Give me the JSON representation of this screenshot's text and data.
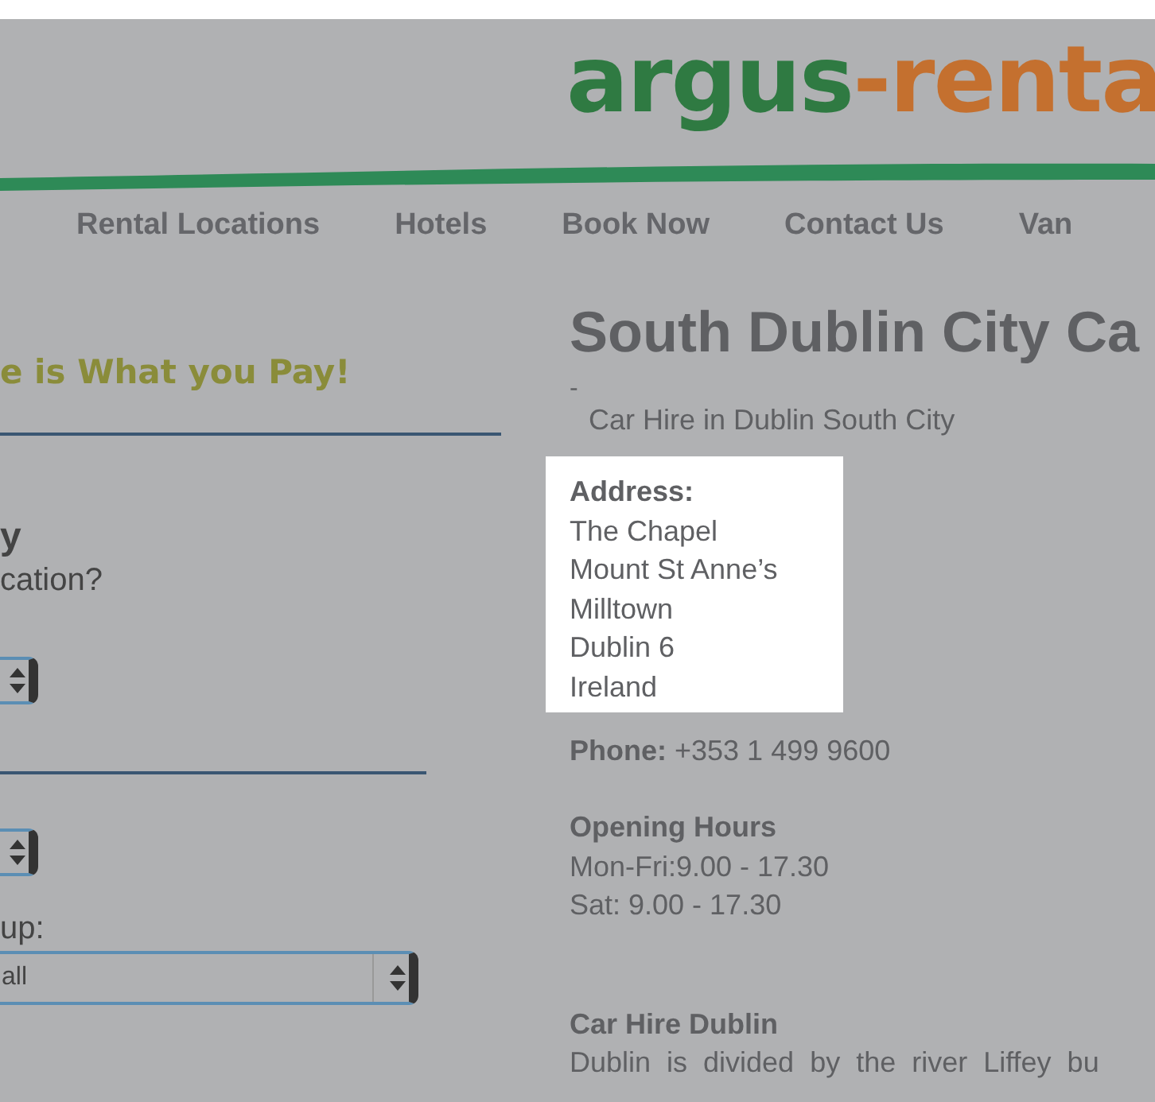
{
  "logo": {
    "first": "argus",
    "second": "-renta"
  },
  "nav": [
    "Rental Locations",
    "Hotels",
    "Book Now",
    "Contact Us",
    "Van "
  ],
  "left": {
    "tagline": "e is What you Pay!",
    "heading": "y",
    "question": "cation?",
    "group_label": "up:",
    "group_select": {
      "value": "all"
    }
  },
  "right": {
    "title": "South Dublin City Ca",
    "dash": "-",
    "subtitle": "Car Hire in Dublin South City",
    "address": {
      "label": "Address:",
      "lines": [
        "The Chapel",
        "Mount St Anne’s",
        "Milltown",
        "Dublin 6",
        "Ireland"
      ]
    },
    "phone": {
      "label": "Phone:",
      "value": "+353 1 499 9600"
    },
    "hours": {
      "label": "Opening Hours",
      "lines": [
        "Mon-Fri:9.00 - 17.30",
        "Sat: 9.00 - 17.30"
      ]
    },
    "section": {
      "heading": "Car Hire Dublin",
      "lines": [
        "Dublin is divided by the river Liffey bu"
      ]
    }
  }
}
